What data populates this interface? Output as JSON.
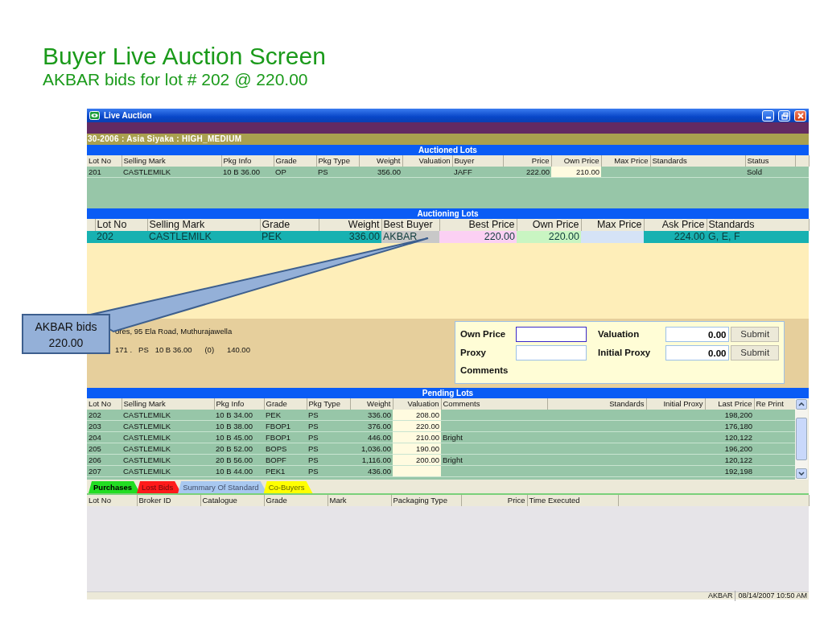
{
  "slide": {
    "title": "Buyer Live Auction Screen",
    "subtitle": "AKBAR bids for lot # 202 @ 220.00"
  },
  "window": {
    "title": "Live Auction"
  },
  "sale_info": "30-2006 : Asia Siyaka  : HIGH_MEDIUM",
  "auctioned_lots": {
    "title": "Auctioned Lots",
    "columns": [
      "Lot No",
      "Selling Mark",
      "Pkg Info",
      "Grade",
      "Pkg Type",
      "Weight",
      "Valuation",
      "Buyer",
      "Price",
      "Own Price",
      "Max Price",
      "Standards",
      "Status"
    ],
    "rows": [
      {
        "lot_no": "201",
        "selling_mark": "CASTLEMILK",
        "pkg_info": "10 B 36.00",
        "grade": "OP",
        "pkg_type": "PS",
        "weight": "356.00",
        "buyer": "JAFF",
        "price": "222.00",
        "own_price": "210.00",
        "status": "Sold"
      }
    ]
  },
  "auctioning_lots": {
    "title": "Auctioning Lots",
    "columns": [
      "Lot No",
      "Selling Mark",
      "Grade",
      "Weight",
      "Best Buyer",
      "Best Price",
      "Own Price",
      "Max Price",
      "Ask Price",
      "Standards"
    ],
    "rows": [
      {
        "lot_no": "202",
        "selling_mark": "CASTLEMILK",
        "grade": "PEK",
        "weight": "336.00",
        "best_buyer": "AKBAR",
        "best_price": "220.00",
        "own_price": "220.00",
        "ask_price": "224.00",
        "standards": "G, E, F"
      }
    ]
  },
  "seller_info": {
    "address": "ores, 95 Ela Road, Muthurajawella",
    "details": "171 .   PS   10 B 36.00      (0)      140.00"
  },
  "bid_form": {
    "own_price": {
      "label": "Own Price",
      "focused": true
    },
    "proxy": {
      "label": "Proxy",
      "focused": false
    },
    "valuation": {
      "label": "Valuation",
      "value": "0.00",
      "button": "Submit"
    },
    "initial_proxy": {
      "label": "Initial Proxy",
      "value": "0.00",
      "button": "Submit"
    },
    "comments": {
      "label": "Comments"
    }
  },
  "pending_lots": {
    "title": "Pending Lots",
    "columns": [
      "Lot No",
      "Selling Mark",
      "Pkg Info",
      "Grade",
      "Pkg Type",
      "Weight",
      "Valuation",
      "Comments",
      "Standards",
      "Initial Proxy",
      "Last Price",
      "Re Print"
    ],
    "rows": [
      {
        "lot_no": "202",
        "selling_mark": "CASTLEMILK",
        "pkg_info": "10 B 34.00",
        "grade": "PEK",
        "pkg_type": "PS",
        "weight": "336.00",
        "valuation": "208.00",
        "last_price": "198,200"
      },
      {
        "lot_no": "203",
        "selling_mark": "CASTLEMILK",
        "pkg_info": "10 B 38.00",
        "grade": "FBOP1",
        "pkg_type": "PS",
        "weight": "376.00",
        "valuation": "220.00",
        "last_price": "176,180"
      },
      {
        "lot_no": "204",
        "selling_mark": "CASTLEMILK",
        "pkg_info": "10 B 45.00",
        "grade": "FBOP1",
        "pkg_type": "PS",
        "weight": "446.00",
        "valuation": "210.00",
        "comments": "Bright",
        "last_price": "120,122"
      },
      {
        "lot_no": "205",
        "selling_mark": "CASTLEMILK",
        "pkg_info": "20 B 52.00",
        "grade": "BOPS",
        "pkg_type": "PS",
        "weight": "1,036.00",
        "valuation": "190.00",
        "last_price": "196,200"
      },
      {
        "lot_no": "206",
        "selling_mark": "CASTLEMILK",
        "pkg_info": "20 B 56.00",
        "grade": "BOPF",
        "pkg_type": "PS",
        "weight": "1,116.00",
        "valuation": "200.00",
        "comments": "Bright",
        "last_price": "120,122"
      },
      {
        "lot_no": "207",
        "selling_mark": "CASTLEMILK",
        "pkg_info": "10 B 44.00",
        "grade": "PEK1",
        "pkg_type": "PS",
        "weight": "436.00",
        "last_price": "192,198"
      }
    ]
  },
  "tabs": [
    {
      "label": "Purchases",
      "selected": true,
      "color": "#22dd22"
    },
    {
      "label": "Lost Bids",
      "selected": false,
      "color": "#ff1a1a"
    },
    {
      "label": "Summary Of Standard",
      "selected": false,
      "color": "#a8c8f0"
    },
    {
      "label": "Co-Buyers",
      "selected": false,
      "color": "#ffff00"
    }
  ],
  "purchases": {
    "columns": [
      "Lot No",
      "Broker ID",
      "Catalogue",
      "Grade",
      "Mark",
      "Packaging Type",
      "Price",
      "Time Executed"
    ]
  },
  "status_bar": {
    "user": "AKBAR",
    "datetime": "08/14/2007 10:50 AM"
  },
  "callout": {
    "text": "AKBAR bids 220.00"
  }
}
